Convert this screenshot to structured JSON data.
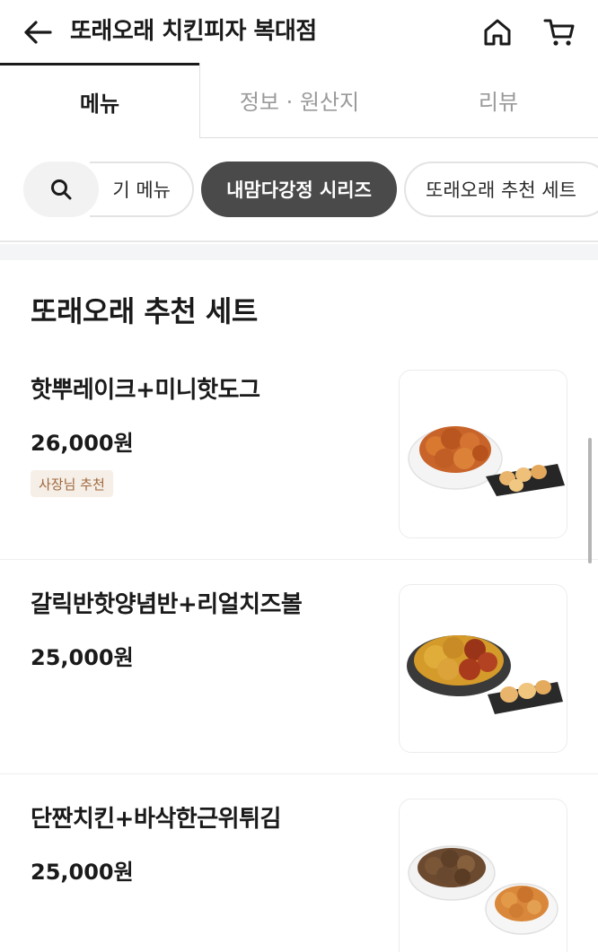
{
  "header": {
    "back_icon": "arrow-left-icon",
    "title": "또래오래 치킨피자 복대점",
    "home_icon": "home-icon",
    "cart_icon": "cart-icon"
  },
  "tabs": [
    {
      "label": "메뉴",
      "active": true
    },
    {
      "label": "정보 · 원산지",
      "active": false
    },
    {
      "label": "리뷰",
      "active": false
    }
  ],
  "categories": {
    "search_icon": "search-icon",
    "chips": [
      {
        "label": "기 메뉴",
        "active": false
      },
      {
        "label": "내맘다강정 시리즈",
        "active": true
      },
      {
        "label": "또래오래 추천 세트",
        "active": false
      }
    ]
  },
  "section": {
    "title": "또래오래 추천 세트"
  },
  "items": [
    {
      "name": "핫뿌레이크+미니핫도그",
      "price": "26,000원",
      "badge": "사장님 추천"
    },
    {
      "name": "갈릭반핫양념반+리얼치즈볼",
      "price": "25,000원"
    },
    {
      "name": "단짠치킨+바삭한근위튀김",
      "price": "25,000원"
    }
  ],
  "colors": {
    "active_chip": "#4a4a4a",
    "badge_bg": "#f5efe8",
    "badge_text": "#a0673c"
  }
}
